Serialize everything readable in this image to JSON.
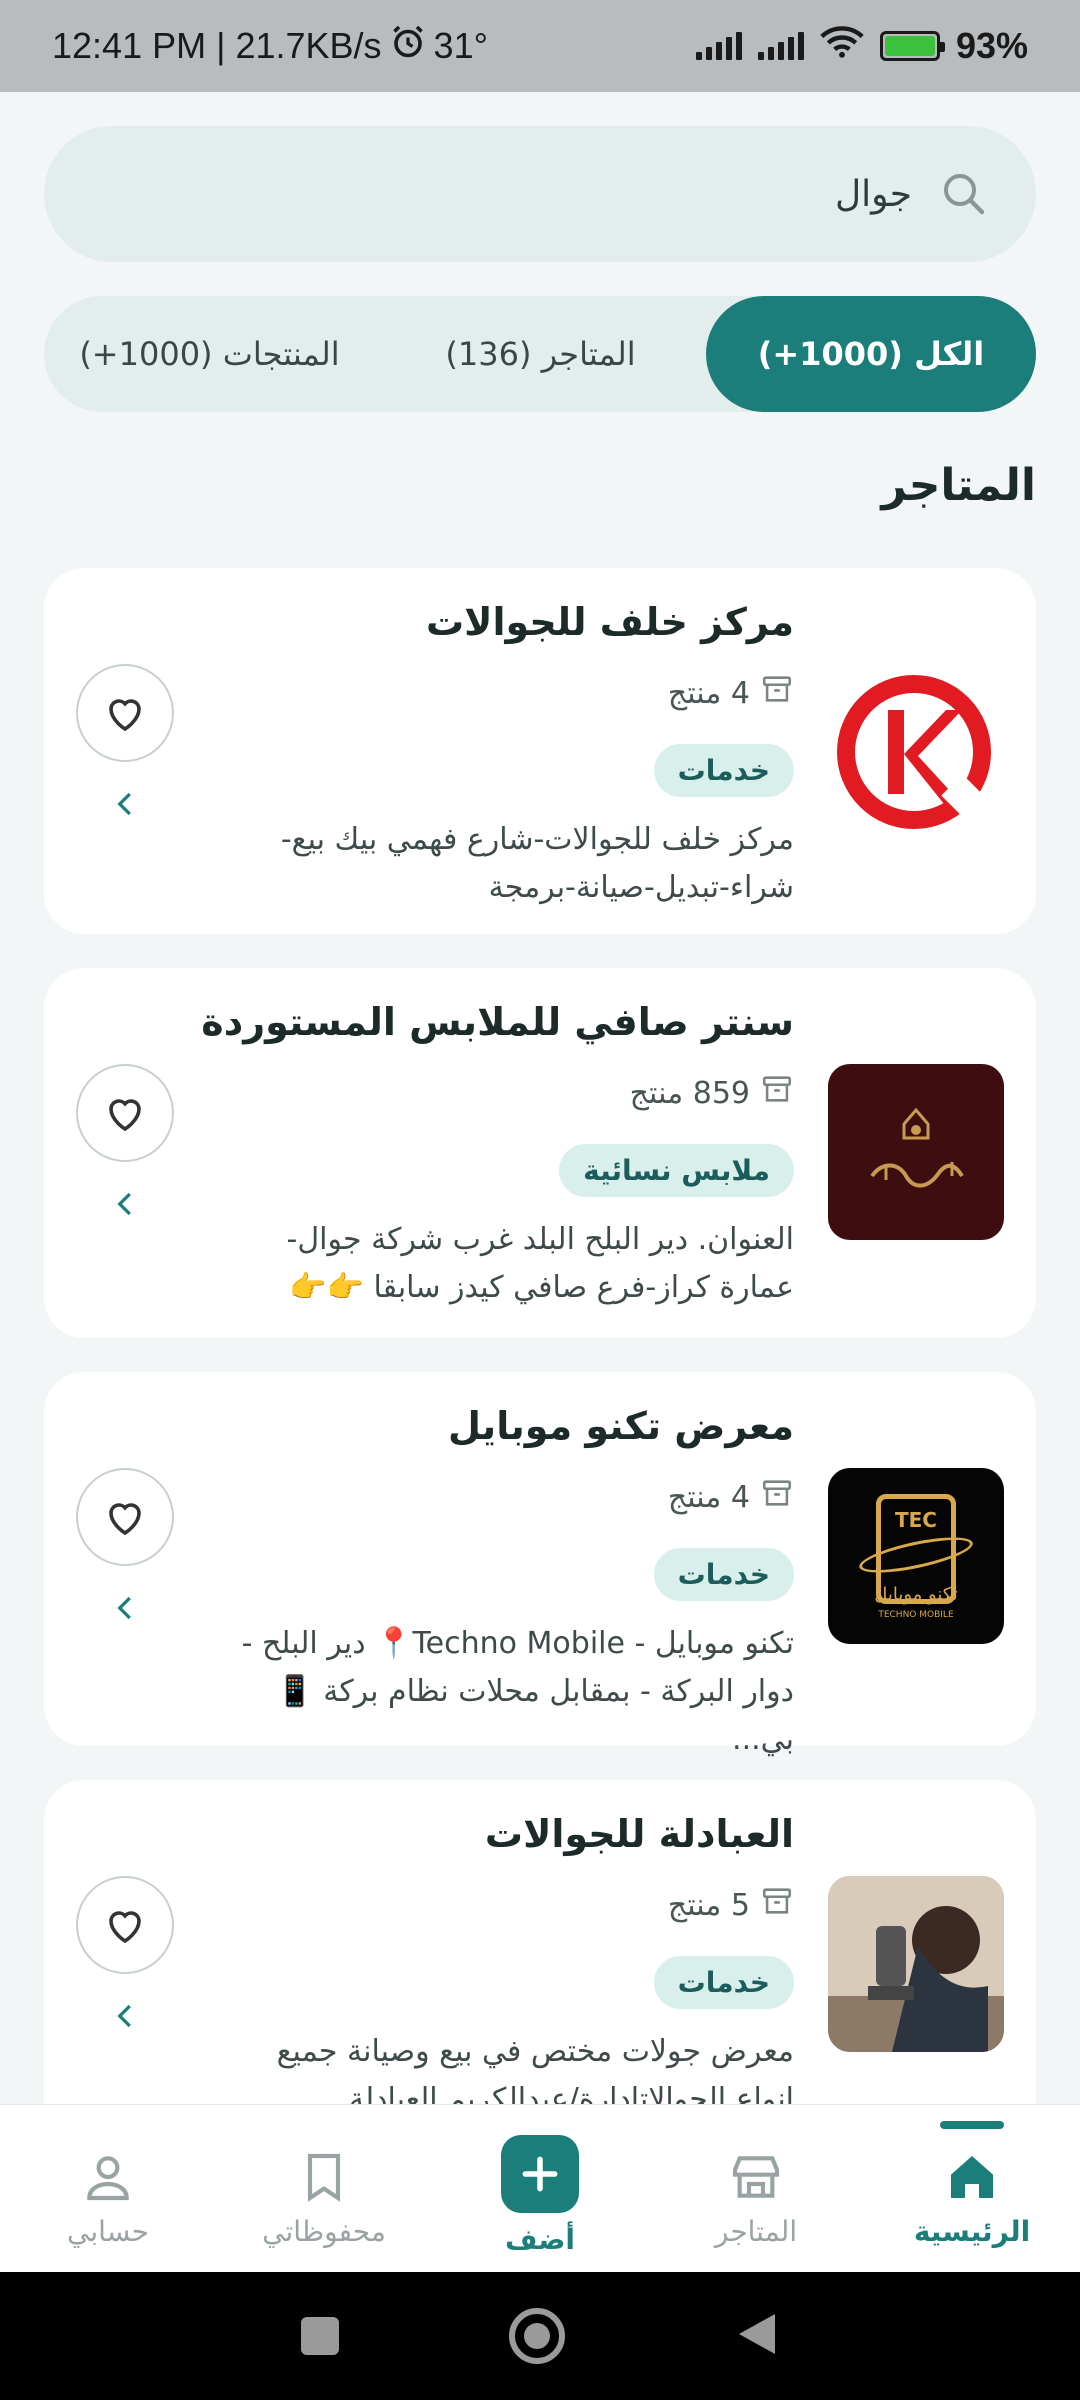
{
  "status_bar": {
    "time_speed": "12:41 PM | 21.7KB/s",
    "temperature": "31°",
    "battery": "93%"
  },
  "search": {
    "value": "جوال",
    "icon": "search-icon"
  },
  "tabs": [
    {
      "label": "الكل (1000+)",
      "active": true
    },
    {
      "label": "المتاجر (136)",
      "active": false
    },
    {
      "label": "المنتجات (1000+)",
      "active": false
    }
  ],
  "section_title": "المتاجر",
  "stores": [
    {
      "name": "مركز خلف للجوالات",
      "count": "4 منتج",
      "category": "خدمات",
      "desc_line1": "مركز خلف للجوالات-شارع فهمي بيك بيع-",
      "desc_line2": "شراء-تبديل-صيانة-برمجة"
    },
    {
      "name": "سنتر صافي للملابس المستوردة",
      "count": "859 منتج",
      "category": "ملابس نسائية",
      "desc_line1": "العنوان. دير البلح البلد غرب شركة جوال-",
      "desc_line2": "عمارة كراز-فرع صافي كيدز سابقا 👉👉"
    },
    {
      "name": "معرض تكنو موبايل",
      "count": "4 منتج",
      "category": "خدمات",
      "desc_line1": "تكنو موبايل - Techno Mobile📍 دير البلح -",
      "desc_line2": "دوار البركة - بمقابل محلات نظام بركة 📱 بي..."
    },
    {
      "name": "العبادلة للجوالات",
      "count": "5 منتج",
      "category": "خدمات",
      "desc_line1": "معرض جولات مختص في بيع وصيانة جميع",
      "desc_line2": "انواع الجوالاتادارة/عبدالكريم العبادلة"
    }
  ],
  "logo_texts": {
    "tec": "TEC",
    "tech_ar": "تكنو موبايل",
    "tech_en": "TECHNO MOBILE"
  },
  "bottom_nav": [
    {
      "label": "الرئيسية",
      "icon": "home-icon",
      "active": true
    },
    {
      "label": "المتاجر",
      "icon": "store-icon",
      "active": false
    },
    {
      "label": "أضف",
      "icon": "plus-icon",
      "active": false
    },
    {
      "label": "محفوظاتي",
      "icon": "bookmark-icon",
      "active": false
    },
    {
      "label": "حسابي",
      "icon": "user-icon",
      "active": false
    }
  ],
  "colors": {
    "primary": "#1b7e7a",
    "background": "#f2f6f6",
    "badge_bg": "#d9efec"
  }
}
